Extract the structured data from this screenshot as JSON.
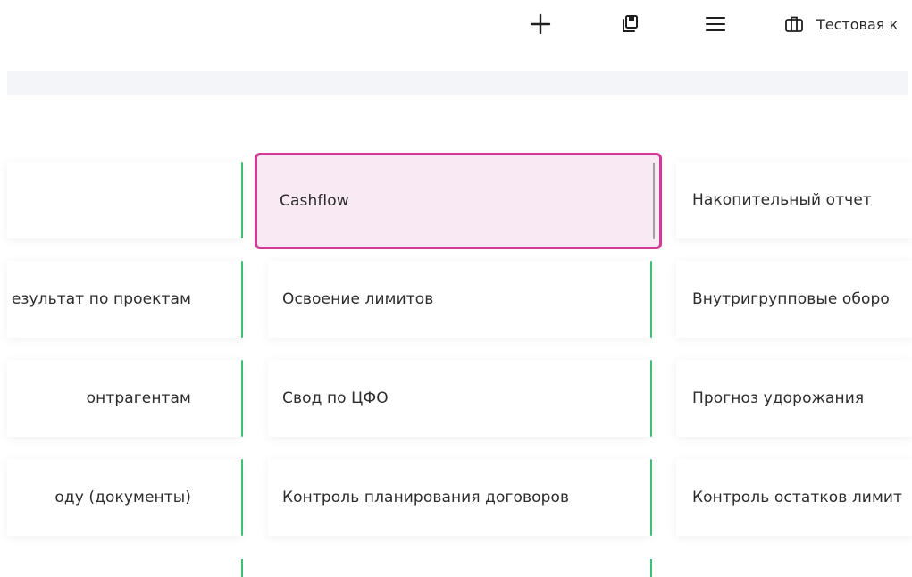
{
  "header": {
    "icons": {
      "add": "plus-icon",
      "copy": "copy-icon",
      "menu": "menu-icon",
      "company": "briefcase-icon"
    },
    "company_name": "Тестовая к"
  },
  "colors": {
    "accent_green": "#3fbf73",
    "selected_border": "#d23a96",
    "selected_bg": "#f9e9f3"
  },
  "reports": {
    "col1": [
      "",
      "езультат по проектам",
      "онтрагентам",
      "оду (документы)"
    ],
    "col2": [
      "Cashflow",
      "Освоение лимитов",
      "Свод по ЦФО",
      "Контроль планирования договоров"
    ],
    "col3": [
      "Накопительный отчет",
      "Внутригрупповые оборо",
      "Прогноз удорожания",
      "Контроль остатков лимит"
    ]
  }
}
